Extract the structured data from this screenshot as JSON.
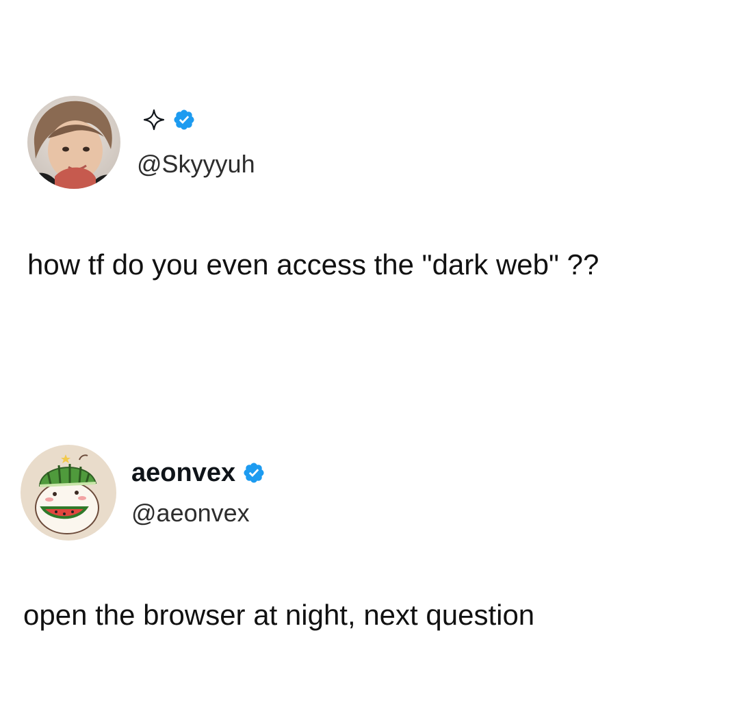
{
  "tweets": [
    {
      "display_name": "",
      "handle": "@Skyyyuh",
      "verified": true,
      "name_icon": "sparkle-icon",
      "text": "how tf do you even access the \"dark web\" ??"
    },
    {
      "display_name": "aeonvex",
      "handle": "@aeonvex",
      "verified": true,
      "text": "open the browser at night, next question"
    }
  ],
  "colors": {
    "verified_blue": "#1d9bf0",
    "text": "#111111",
    "background": "#ffffff"
  }
}
